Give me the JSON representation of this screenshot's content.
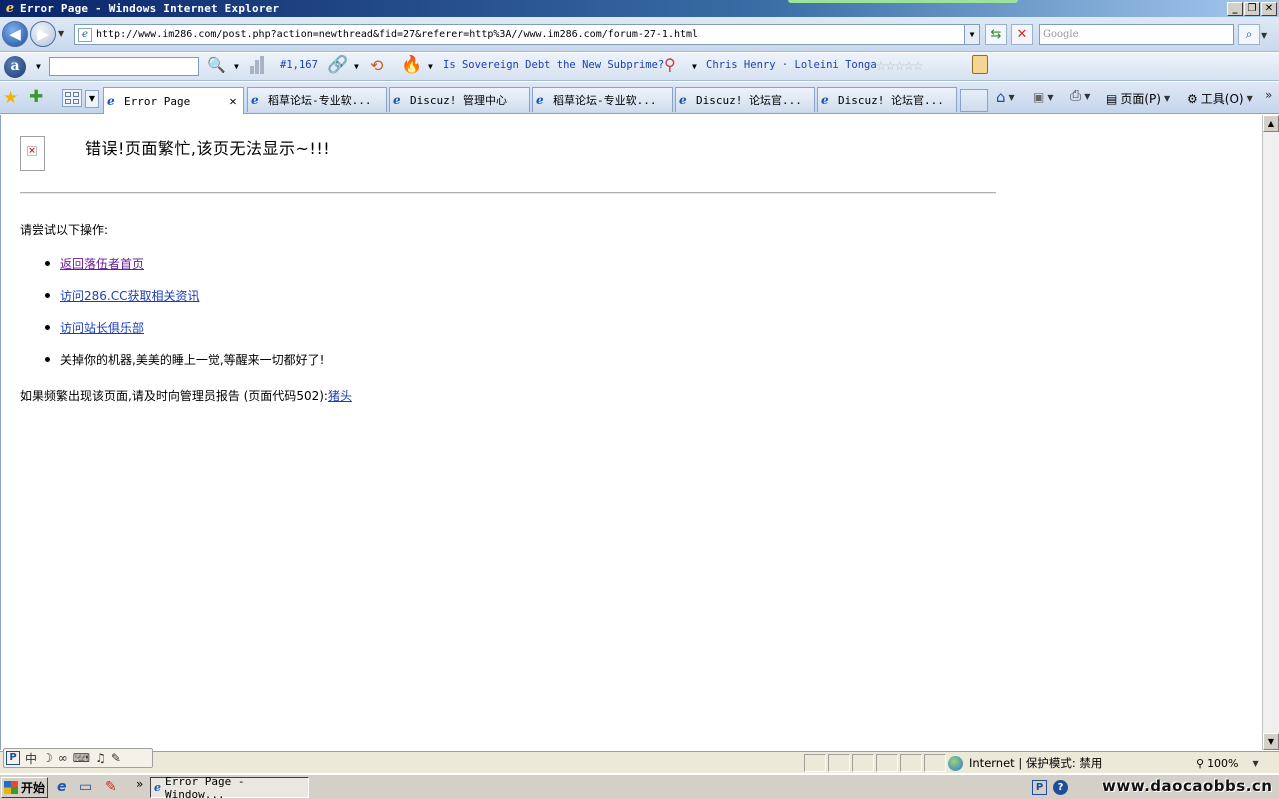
{
  "window": {
    "title": "Error Page - Windows Internet Explorer",
    "controls": {
      "minimize": "_",
      "restore": "❐",
      "close": "✕"
    }
  },
  "address_bar": {
    "url": "http://www.im286.com/post.php?action=newthread&fid=27&referer=http%3A//www.im286.com/forum-27-1.html",
    "search_placeholder": "Google"
  },
  "alexa_toolbar": {
    "logo_letter": "a",
    "rank": "#1,167",
    "hot_topic": "Is Sovereign Debt the New Subprime?",
    "person_link": "Chris Henry · Loleini Tonga",
    "stars": "☆☆☆☆☆"
  },
  "tabs": [
    {
      "label": "Error Page",
      "active": true
    },
    {
      "label": "稻草论坛-专业软...",
      "active": false
    },
    {
      "label": "Discuz! 管理中心",
      "active": false
    },
    {
      "label": "稻草论坛-专业软...",
      "active": false
    },
    {
      "label": "Discuz! 论坛官...",
      "active": false
    },
    {
      "label": "Discuz! 论坛官...",
      "active": false
    }
  ],
  "command_bar": {
    "page_label": "页面(P)",
    "tools_label": "工具(O)"
  },
  "content": {
    "error_title": "错误!页面繁忙,该页无法显示~!!!",
    "try_label": "请尝试以下操作:",
    "options": [
      {
        "text": "返回落伍者首页",
        "link": true
      },
      {
        "text": "访问286.CC获取相关资讯",
        "link": true
      },
      {
        "text": "访问站长俱乐部",
        "link": true
      },
      {
        "text": "关掉你的机器,美美的睡上一觉,等醒来一切都好了!",
        "link": false
      }
    ],
    "report_text": "如果频繁出现该页面,请及时向管理员报告 (页面代码502):",
    "report_link": "猪头"
  },
  "status_bar": {
    "zone": "Internet | 保护模式: 禁用",
    "zoom": "100%"
  },
  "ime_bar": {
    "items": [
      "中",
      "☽",
      "∞",
      "⌨",
      "♫",
      "✎"
    ]
  },
  "taskbar": {
    "start_label": "开始",
    "task_label": "Error Page - Window...",
    "watermark": "www.daocaobbs.cn"
  },
  "colors": {
    "link": "#1a3fb5",
    "visited_link": "#6a1b9a",
    "title_bar": "#0a246a"
  }
}
